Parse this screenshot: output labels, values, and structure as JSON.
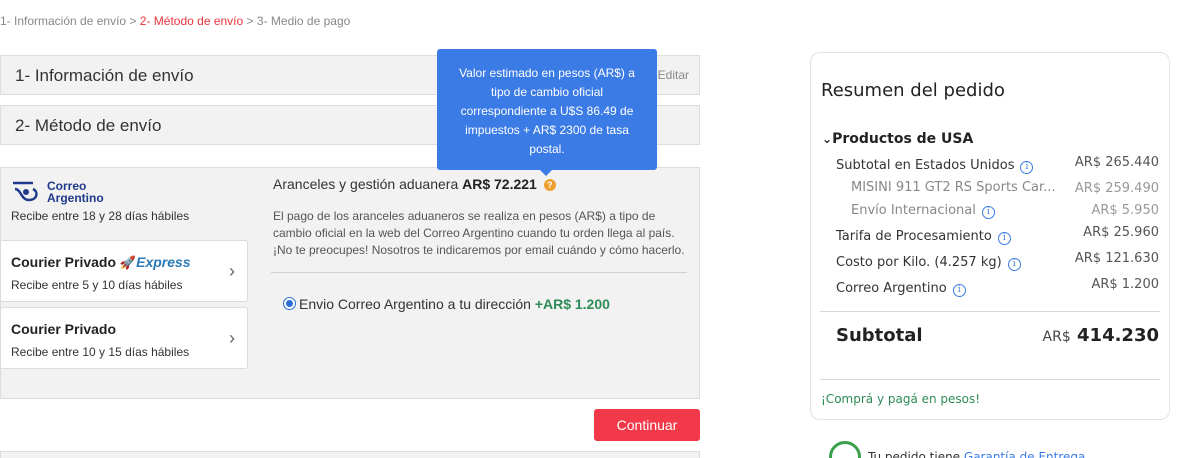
{
  "breadcrumb": {
    "step1": "1- Información de envío",
    "sep": ">",
    "step2": "2- Método de envío",
    "step3": "3- Medio de pago"
  },
  "sections": {
    "info_title": "1- Información de envío",
    "edit_label": "Editar",
    "method_title": "2- Método de envío"
  },
  "tooltip": {
    "text": "Valor estimado en pesos (AR$) a tipo de cambio oficial correspondiente a U$S 86.49 de impuestos + AR$ 2300 de tasa postal."
  },
  "shipping_options": {
    "correo": {
      "logo_text_1": "Correo",
      "logo_text_2": "Argentino",
      "delivery": "Recibe entre 18 y 28 días hábiles"
    },
    "courier_express": {
      "name": "Courier Privado",
      "badge": "Express",
      "delivery": "Recibe entre 5 y 10 días hábiles"
    },
    "courier": {
      "name": "Courier Privado",
      "delivery": "Recibe entre 10 y 15 días hábiles"
    }
  },
  "customs": {
    "title": "Aranceles y gestión aduanera",
    "amount": "AR$ 72.221",
    "description": "El pago de los aranceles aduaneros se realiza en pesos (AR$) a tipo de cambio oficial en la web del Correo Argentino cuando tu orden llega al país. ¡No te preocupes! Nosotros te indicaremos por email cuándo y cómo hacerlo.",
    "option_label": "Envio Correo Argentino a tu dirección",
    "option_price": "+AR$ 1.200"
  },
  "continue_label": "Continuar",
  "summary": {
    "title": "Resumen del pedido",
    "products_label": "Productos de USA",
    "rows": [
      {
        "label": "Subtotal en Estados Unidos",
        "value": "AR$ 265.440"
      },
      {
        "label": "MISINI 911 GT2 RS Sports Car...",
        "value": "AR$ 259.490"
      },
      {
        "label": "Envío Internacional",
        "value": "AR$ 5.950"
      },
      {
        "label": "Tarifa de Procesamiento",
        "value": "AR$ 25.960"
      },
      {
        "label": "Costo por Kilo. (4.257 kg)",
        "value": "AR$ 121.630"
      },
      {
        "label": "Correo Argentino",
        "value": "AR$ 1.200"
      }
    ],
    "subtotal_label": "Subtotal",
    "subtotal_currency": "AR$",
    "subtotal_value": "414.230",
    "note": "¡Comprá y pagá en pesos!"
  },
  "guarantee": {
    "text": "Tu pedido tiene",
    "link": "Garantía de Entrega"
  },
  "colors": {
    "accent_red": "#f2394a",
    "tooltip_blue": "#3b7be5",
    "price_green": "#2e8b57"
  }
}
